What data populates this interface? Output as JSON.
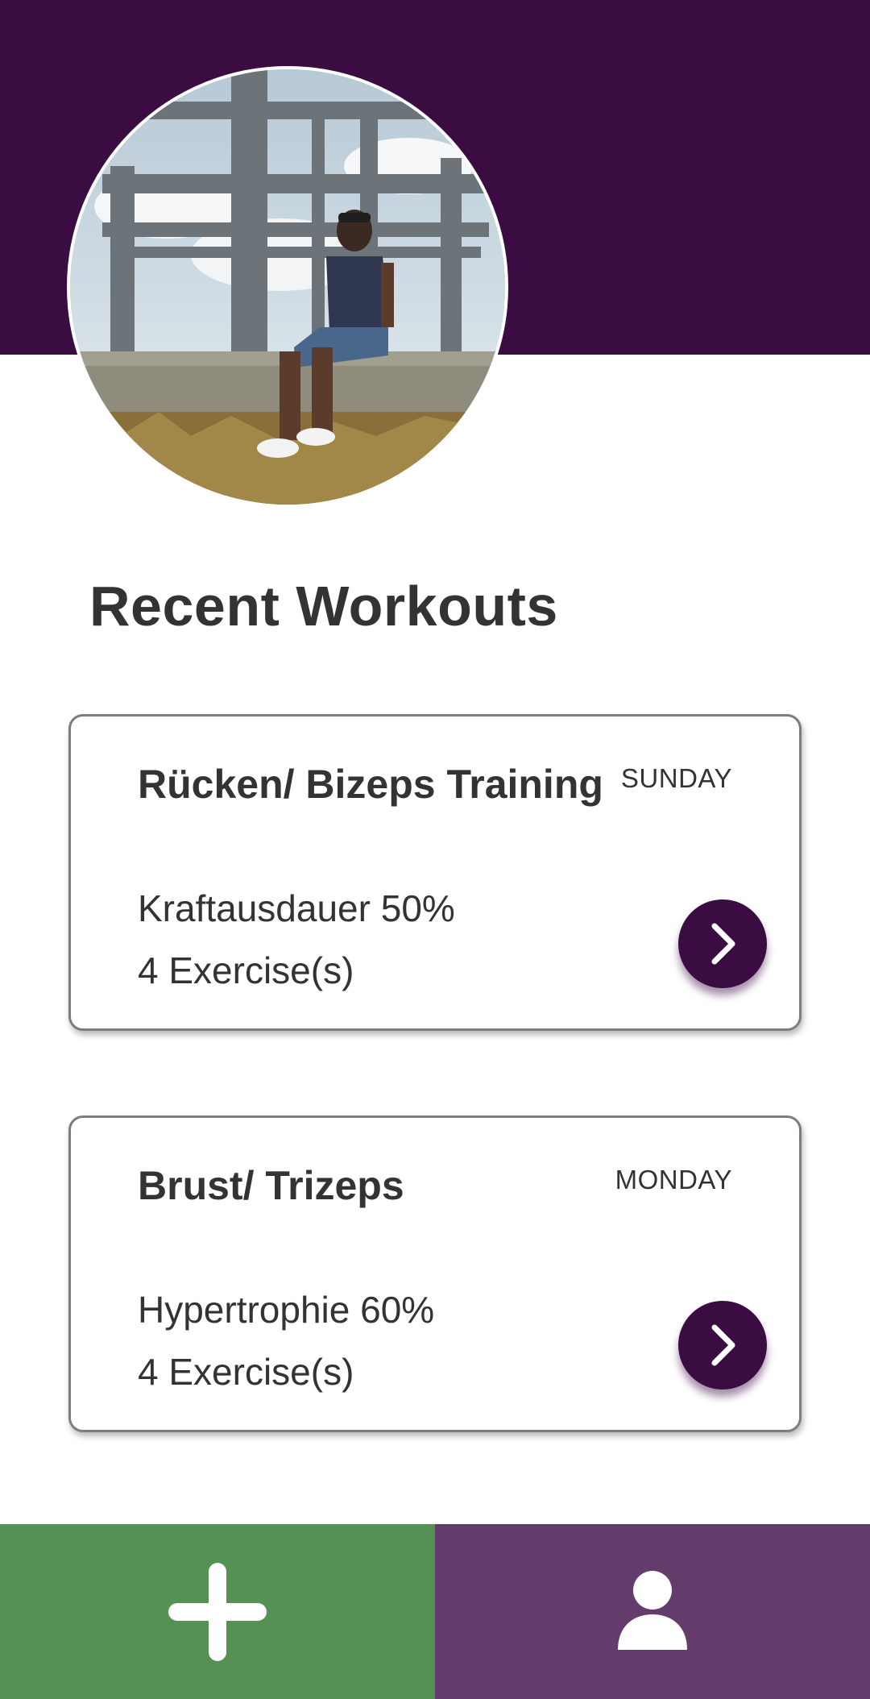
{
  "section": {
    "title": "Recent Workouts"
  },
  "workouts": [
    {
      "title": "Rücken/ Bizeps Training",
      "day": "SUNDAY",
      "intensity": "Kraftausdauer 50%",
      "exercises": "4 Exercise(s)"
    },
    {
      "title": "Brust/ Trizeps",
      "day": "MONDAY",
      "intensity": "Hypertrophie 60%",
      "exercises": "4 Exercise(s)"
    }
  ],
  "icons": {
    "open_workout": "chevron-right-icon",
    "add": "plus-icon",
    "profile": "person-icon"
  },
  "colors": {
    "header": "#3a0c42",
    "accent": "#3a0c42",
    "add_bar": "#559155",
    "profile_bar": "#643c6c",
    "text": "#333333"
  }
}
